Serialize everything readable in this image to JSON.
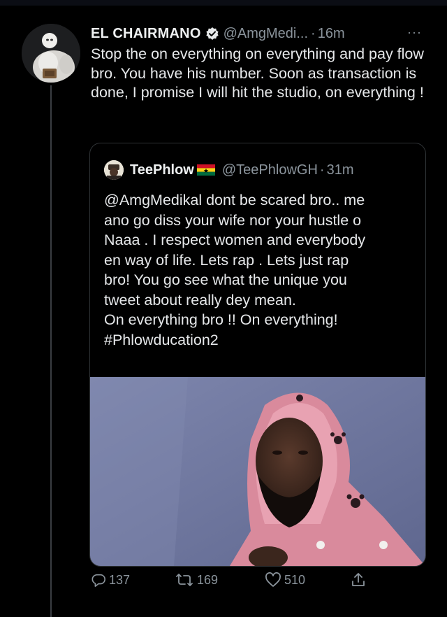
{
  "tweet": {
    "display_name": "EL CHAIRMANO",
    "handle": "@AmgMedi...",
    "separator": "·",
    "time": "16m",
    "text": "Stop the on everything on everything and pay flow bro. You have his number. Soon as transaction is done, I promise I will hit the studio, on everything !",
    "more_icon": "···"
  },
  "quoted_tweet": {
    "display_name": "TeePhlow",
    "handle": "@TeePhlowGH",
    "separator": "·",
    "time": "31m",
    "text_lines": [
      "@AmgMedikal dont be scared bro.. me",
      "ano go diss your wife nor your hustle o",
      "Naaa . I respect women and everybody",
      "en way of life. Lets rap . Lets just rap",
      "bro! You go see what the unique you",
      "tweet about really dey mean.",
      "On everything bro !! On everything!",
      "#Phlowducation2"
    ]
  },
  "actions": {
    "replies": "137",
    "retweets": "169",
    "likes": "510"
  },
  "colors": {
    "background": "#000000",
    "secondary_text": "#8b949c",
    "border": "#2f3336"
  }
}
